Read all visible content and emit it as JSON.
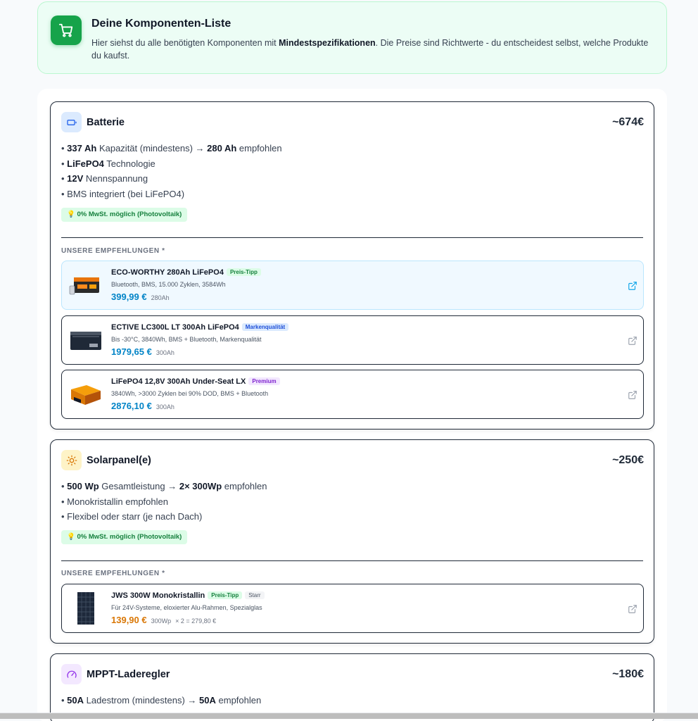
{
  "intro": {
    "title": "Deine Komponenten-Liste",
    "text_before": "Hier siehst du alle benötigten Komponenten mit ",
    "text_bold": "Mindestspezifikationen",
    "text_after": ". Die Preise sind Richtwerte - du entscheidest selbst, welche Produkte du kaufst.",
    "icon": "shopping-cart-icon"
  },
  "recommend_label": "UNSERE EMPFEHLUNGEN *",
  "battery": {
    "title": "Batterie",
    "price": "~674€",
    "icon": "battery-icon",
    "specs": [
      {
        "b1": "337 Ah",
        "t1": " Kapazität (mindestens) → ",
        "b2": "280 Ah",
        "t2": " empfohlen"
      },
      {
        "b1": "LiFePO4",
        "t1": " Technologie",
        "b2": "",
        "t2": ""
      },
      {
        "b1": "12V",
        "t1": " Nennspannung",
        "b2": "",
        "t2": ""
      },
      {
        "b1": "",
        "t1": "BMS integriert (bei LiFePO4)",
        "b2": "",
        "t2": ""
      }
    ],
    "tax_note": "💡 0% MwSt. möglich (Photovoltaik)",
    "products": [
      {
        "name": "ECO-WORTHY 280Ah LiFePO4",
        "badge": "Preis-Tipp",
        "desc": "Bluetooth, BMS, 15.000 Zyklen, 3584Wh",
        "price": "399,99 €",
        "cap": "280Ah"
      },
      {
        "name": "ECTIVE LC300L LT 300Ah LiFePO4",
        "badge": "Markenqualität",
        "desc": "Bis -30°C, 3840Wh, BMS + Bluetooth, Markenqualität",
        "price": "1979,65 €",
        "cap": "300Ah"
      },
      {
        "name": "LiFePO4 12,8V 300Ah Under-Seat LX",
        "badge": "Premium",
        "desc": "3840Wh, >3000 Zyklen bei 90% DOD, BMS + Bluetooth",
        "price": "2876,10 €",
        "cap": "300Ah"
      }
    ]
  },
  "solar": {
    "title": "Solarpanel(e)",
    "price": "~250€",
    "icon": "sun-icon",
    "specs": [
      {
        "b1": "500 Wp",
        "t1": " Gesamtleistung → ",
        "b2": "2× 300Wp",
        "t2": " empfohlen"
      },
      {
        "b1": "",
        "t1": "Monokristallin empfohlen",
        "b2": "",
        "t2": ""
      },
      {
        "b1": "",
        "t1": "Flexibel oder starr (je nach Dach)",
        "b2": "",
        "t2": ""
      }
    ],
    "tax_note": "💡 0% MwSt. möglich (Photovoltaik)",
    "products": [
      {
        "name": "JWS 300W Monokristallin",
        "badge": "Preis-Tipp",
        "badge2": "Starr",
        "desc": "Für 24V-Systeme, eloxierter Alu-Rahmen, Spezialglas",
        "price": "139,90 €",
        "cap": "300Wp",
        "mult": "× 2 = 279,80 €"
      }
    ]
  },
  "mppt": {
    "title": "MPPT-Laderegler",
    "price": "~180€",
    "icon": "gauge-icon",
    "specs": [
      {
        "b1": "50A",
        "t1": " Ladestrom (mindestens) → ",
        "b2": "50A",
        "t2": " empfohlen"
      }
    ]
  },
  "colors": {
    "accent_blue": "#0284c7",
    "accent_orange": "#d97706",
    "accent_green": "#16a34a"
  }
}
